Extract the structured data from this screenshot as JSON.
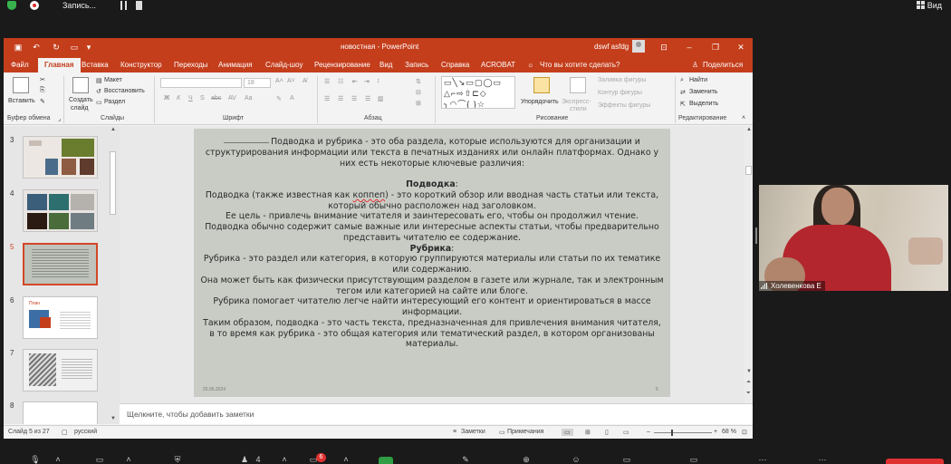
{
  "system_bar": {
    "recording_label": "Запись...",
    "view_label": "Вид"
  },
  "window": {
    "title": "новостная - PowerPoint",
    "user": "dswf asfdg"
  },
  "ribbon_tabs": [
    "Файл",
    "Главная",
    "Вставка",
    "Конструктор",
    "Переходы",
    "Анимация",
    "Слайд-шоу",
    "Рецензирование",
    "Вид",
    "Запись",
    "Справка",
    "ACROBAT"
  ],
  "tell_me": "Что вы хотите сделать?",
  "share_label": "Поделиться",
  "ribbon": {
    "paste": "Вставить",
    "create_slide_line1": "Создать",
    "create_slide_line2": "слайд",
    "layout": "Макет",
    "reset": "Восстановить",
    "section": "Раздел",
    "font_size": "18",
    "arrange_line1": "Упорядочить",
    "quick_styles_line1": "Экспресс-",
    "quick_styles_line2": "стили",
    "shape_fill": "Заливка фигуры",
    "shape_outline": "Контур фигуры",
    "shape_effects": "Эффекты фигуры",
    "find": "Найти",
    "replace": "Заменить",
    "select": "Выделить",
    "groups": {
      "clipboard": "Буфер обмена",
      "slides": "Слайды",
      "font": "Шрифт",
      "paragraph": "Абзац",
      "drawing": "Рисование",
      "editing": "Редактирование"
    }
  },
  "thumbnails": {
    "numbers": [
      "3",
      "4",
      "5",
      "6",
      "7",
      "8"
    ],
    "slide6_title": "План"
  },
  "slide": {
    "p1": "Подводка и рубрика - это оба раздела, которые используются для организации и структурирования информации или текста в печатных изданиях или онлайн платформах. Однако у них есть некоторые ключевые различия:",
    "h1": "Подводка",
    "h1_colon": ":",
    "p2a": "Подводка (также известная как ",
    "p2b": "коппеп",
    "p2c": ") - это короткий обзор или вводная часть статьи или текста, который обычно расположен над заголовком.",
    "p3": "Ее цель - привлечь внимание читателя и заинтересовать его, чтобы он продолжил чтение.",
    "p4": "Подводка обычно содержит самые важные или интересные аспекты статьи, чтобы предварительно представить читателю ее содержание.",
    "h2": "Рубрика",
    "h2_colon": ":",
    "p5": "Рубрика - это раздел или категория, в которую группируются материалы или статьи по их тематике или содержанию.",
    "p6": "Она может быть как физически присутствующим разделом в газете или журнале, так и электронным тегом или категорией на сайте или блоге.",
    "p7": "Рубрика помогает читателю легче найти интересующий его контент и ориентироваться в массе информации.",
    "p8": "Таким образом, подводка - это часть текста, предназначенная для привлечения внимания читателя, в то время как рубрика - это общая категория или тематический раздел, в котором организованы материалы.",
    "footer_date": "20.05.2024",
    "footer_num": "5"
  },
  "notes_placeholder": "Щелкните, чтобы добавить заметки",
  "status": {
    "slide_counter": "Слайд 5 из 27",
    "language": "русский",
    "notes": "Заметки",
    "comments": "Примечания",
    "zoom": "68 %"
  },
  "video": {
    "participant_name": "Холевенкова Е"
  },
  "zoom_toolbar": {
    "participants_count": "4",
    "chat_badge": "6"
  }
}
